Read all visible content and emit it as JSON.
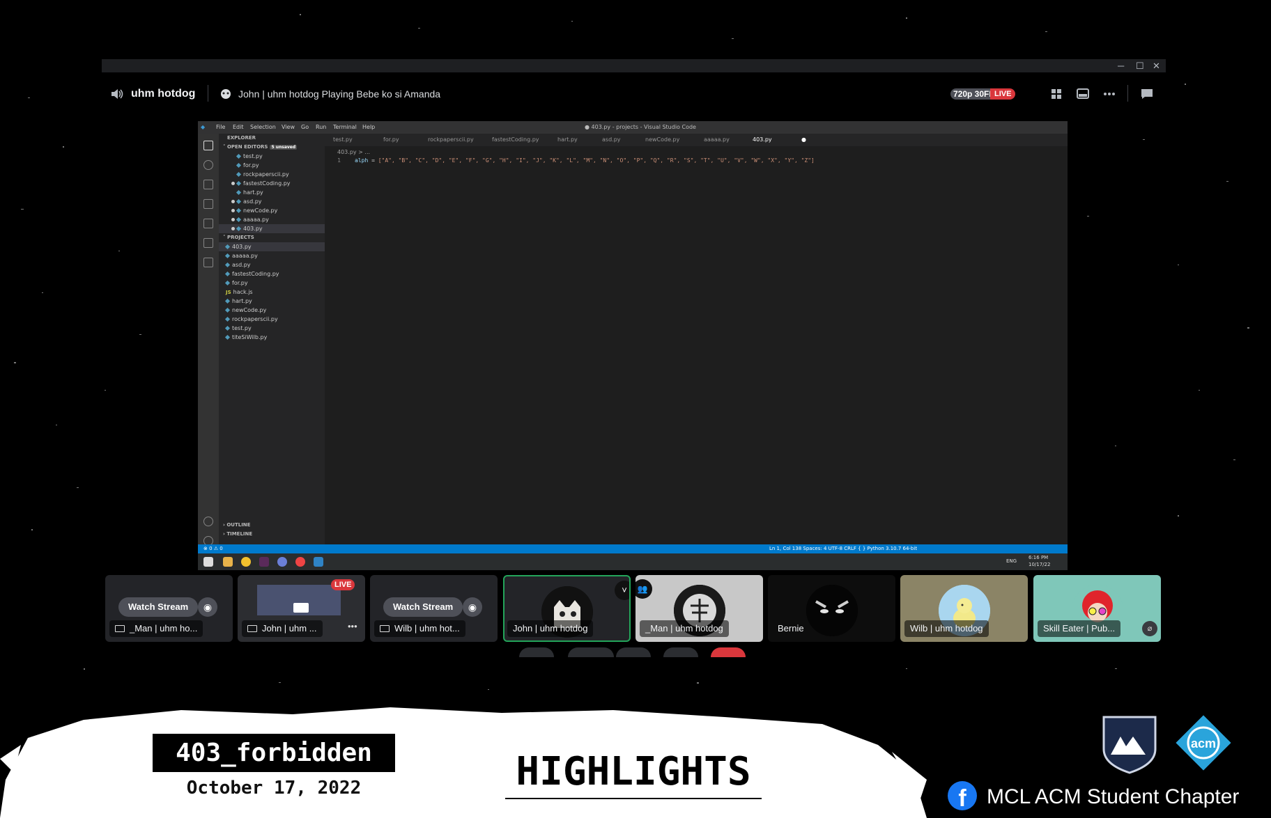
{
  "discord": {
    "window_controls": [
      "─",
      "☐",
      "✕"
    ],
    "channel_name": "uhm hotdog",
    "activity_text": "John | uhm hotdog Playing Bebe ko si Amanda",
    "quality": "720p 30FPS",
    "live_badge": "LIVE",
    "accent_live": "#da373c"
  },
  "vscode": {
    "menu": [
      "File",
      "Edit",
      "Selection",
      "View",
      "Go",
      "Run",
      "Terminal",
      "Help"
    ],
    "window_title": "● 403.py - projects - Visual Studio Code",
    "explorer_title": "EXPLORER",
    "open_editors_title": "OPEN EDITORS",
    "unsaved_badge": "5 unsaved",
    "open_editors": [
      "test.py",
      "for.py",
      "rockpaperscii.py",
      "fastestCoding.py",
      "hart.py",
      "asd.py",
      "newCode.py",
      "aaaaa.py",
      "403.py"
    ],
    "projects_title": "PROJECTS",
    "project_files": [
      "403.py",
      "aaaaa.py",
      "asd.py",
      "fastestCoding.py",
      "for.py",
      "hack.js",
      "hart.py",
      "newCode.py",
      "rockpaperscii.py",
      "test.py",
      "titeSiWilb.py"
    ],
    "outline": "OUTLINE",
    "timeline": "TIMELINE",
    "tabs": [
      "test.py",
      "for.py",
      "rockpaperscii.py",
      "fastestCoding.py",
      "hart.py",
      "asd.py",
      "newCode.py",
      "aaaaa.py",
      "403.py"
    ],
    "breadcrumb": "403.py > ...",
    "line_number": "1",
    "code_var": "alph",
    "code_op": " = ",
    "code_value": "[\"A\", \"B\", \"C\", \"D\", \"E\", \"F\", \"G\", \"H\", \"I\", \"J\", \"K\", \"L\", \"M\", \"N\", \"O\", \"P\", \"Q\", \"R\", \"S\", \"T\", \"U\", \"V\", \"W\", \"X\", \"Y\", \"Z\"]",
    "status_left": "⊗ 0 ⚠ 0",
    "status_right": "Ln 1, Col 138   Spaces: 4   UTF-8   CRLF   { } Python   3.10.7 64-bit",
    "clock_time": "6:16 PM",
    "clock_date": "10/17/22",
    "lang": "ENG"
  },
  "participants": [
    {
      "name": "_Man | uhm ho...",
      "watch": "Watch Stream"
    },
    {
      "name": "John | uhm ...",
      "live": "LIVE"
    },
    {
      "name": "Wilb | uhm hot...",
      "watch": "Watch Stream"
    },
    {
      "name": "John | uhm hotdog"
    },
    {
      "name": "_Man | uhm hotdog"
    },
    {
      "name": "Bernie"
    },
    {
      "name": "Wilb | uhm hotdog"
    },
    {
      "name": "Skill Eater | Pub..."
    }
  ],
  "banner": {
    "team": "403_forbidden",
    "date": "October 17, 2022",
    "heading": "HIGHLIGHTS",
    "org_name": "MCL ACM Student Chapter",
    "acm_logo_text": "acm",
    "fb_letter": "f"
  }
}
